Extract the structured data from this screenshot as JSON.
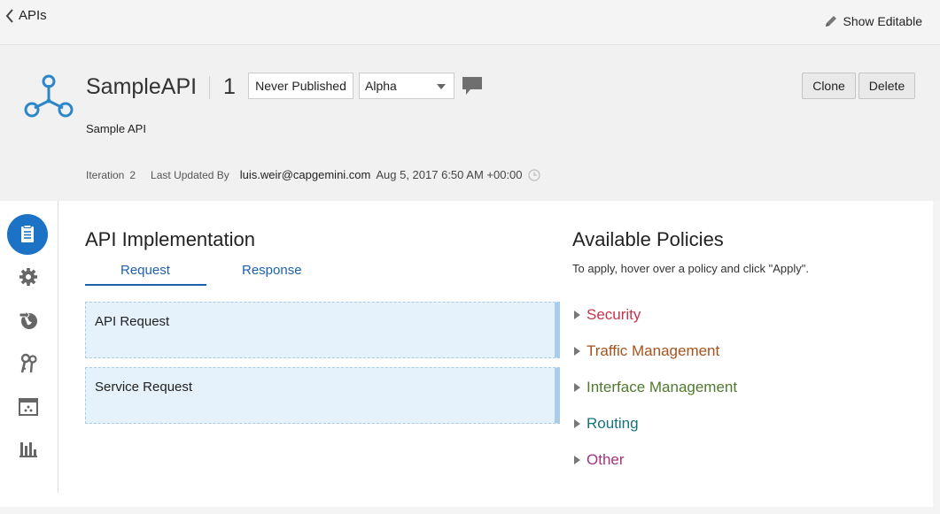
{
  "topbar": {
    "back_label": "APIs",
    "show_editable_label": "Show Editable"
  },
  "api": {
    "name": "SampleAPI",
    "version": "1",
    "publish_status": "Never Published",
    "state": "Alpha",
    "description": "Sample API",
    "clone_label": "Clone",
    "delete_label": "Delete",
    "iteration_label": "Iteration",
    "iteration_value": "2",
    "last_updated_label": "Last Updated By",
    "last_updated_user": "luis.weir@capgemini.com",
    "last_updated_date": "Aug 5, 2017 6:50 AM +00:00"
  },
  "sidenav": {
    "items": [
      {
        "icon": "implementation-icon",
        "active": true
      },
      {
        "icon": "gear-icon"
      },
      {
        "icon": "globe-deploy-icon"
      },
      {
        "icon": "keys-icon"
      },
      {
        "icon": "portal-icon"
      },
      {
        "icon": "analytics-bar-chart-icon"
      }
    ]
  },
  "implementation": {
    "title": "API Implementation",
    "tabs": [
      "Request",
      "Response"
    ],
    "active_tab": "Request",
    "api_request_label": "API Request",
    "service_request_label": "Service Request"
  },
  "policies": {
    "title": "Available Policies",
    "hint": "To apply, hover over a policy and click \"Apply\".",
    "items": [
      {
        "label": "Security",
        "color": "#c7334b"
      },
      {
        "label": "Traffic Management",
        "color": "#a5531d"
      },
      {
        "label": "Interface Management",
        "color": "#4f7a2e"
      },
      {
        "label": "Routing",
        "color": "#167180"
      },
      {
        "label": "Other",
        "color": "#a0357f"
      }
    ]
  },
  "colors": {
    "accent": "#1c72c4",
    "tab_active": "#1c61b0",
    "drop_zone_bg": "#e5f1fb"
  }
}
